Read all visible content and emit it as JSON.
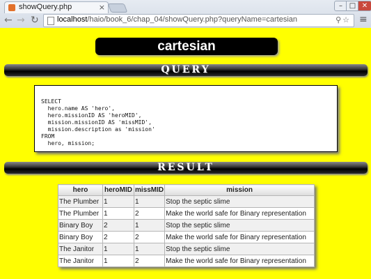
{
  "browser": {
    "tab_title": "showQuery.php",
    "tab_close": "×",
    "url_host": "localhost",
    "url_path": "/haio/book_6/chap_04/showQuery.php?queryName=cartesian",
    "window_controls": {
      "minimize": "–",
      "maximize": "□",
      "close": "✕"
    }
  },
  "page": {
    "title": "cartesian",
    "query_heading": "QUERY",
    "result_heading": "RESULT",
    "query_lines": [
      "SELECT",
      "  hero.name AS 'hero',",
      "  hero.missionID AS 'heroMID',",
      "  mission.missionID AS 'missMID',",
      "  mission.description as 'mission'",
      "FROM",
      "  hero, mission;"
    ],
    "table": {
      "headers": [
        "hero",
        "heroMID",
        "missMID",
        "mission"
      ],
      "rows": [
        [
          "The Plumber",
          "1",
          "1",
          "Stop the septic slime"
        ],
        [
          "The Plumber",
          "1",
          "2",
          "Make the world safe for Binary representation"
        ],
        [
          "Binary Boy",
          "2",
          "1",
          "Stop the septic slime"
        ],
        [
          "Binary Boy",
          "2",
          "2",
          "Make the world safe for Binary representation"
        ],
        [
          "The Janitor",
          "1",
          "1",
          "Stop the septic slime"
        ],
        [
          "The Janitor",
          "1",
          "2",
          "Make the world safe for Binary representation"
        ]
      ]
    }
  },
  "colors": {
    "page_background": "#ffff00",
    "heading_background": "#000000"
  },
  "icons": [
    "back-icon",
    "forward-icon",
    "reload-icon",
    "page-icon",
    "search-icon",
    "star-icon",
    "menu-icon"
  ]
}
